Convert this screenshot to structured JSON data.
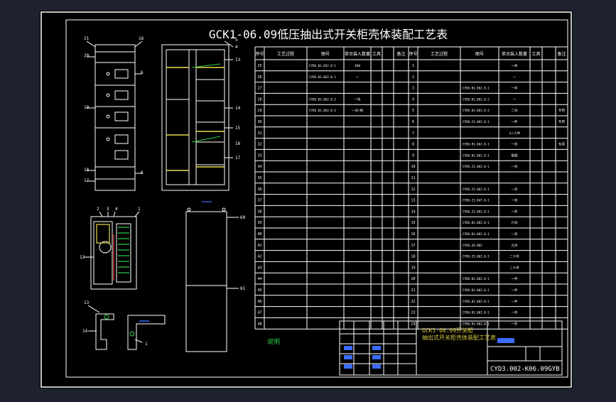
{
  "drawing": {
    "title": "GCK1-06.09低压抽出式开关柜壳体装配工艺表",
    "title_block_name": "GCK1-06.09开关柜抽出式开关柜壳体装配工艺表",
    "drawing_number": "CYD3.002-K06.09GYB",
    "note": "说明"
  },
  "colors": {
    "background": "#000000",
    "frame": "#ffffff",
    "title": "#ffffff",
    "table_text": "#ffffff",
    "accent_blue": "#3a6cff",
    "accent_green": "#2fd24a",
    "accent_yellow": "#e8d94a",
    "accent_red": "#e23a3a",
    "title_block_text": "#d8c840"
  },
  "table": {
    "headers_left": [
      "序号",
      "工艺过程",
      "图号",
      "单台装入数量",
      "工具",
      "备注"
    ],
    "headers_right": [
      "序号",
      "工艺过程",
      "图号",
      "单台装入数量",
      "工具",
      "备注"
    ],
    "left_rows": [
      [
        "25",
        "",
        "CYD6.01.047.0-1",
        "380",
        ""
      ],
      [
        "26",
        "",
        "CYD6.01.062.0-1",
        "一",
        ""
      ],
      [
        "27",
        "",
        "",
        "",
        ""
      ],
      [
        "28",
        "",
        "CYD6.01.062.0-2",
        "一块",
        ""
      ],
      [
        "29",
        "",
        "CYD6.01.062.0-2",
        "一块/根",
        ""
      ],
      [
        "30",
        "",
        "",
        "",
        ""
      ],
      [
        "31",
        "",
        "",
        "",
        ""
      ],
      [
        "32",
        "",
        "",
        "",
        ""
      ],
      [
        "33",
        "",
        "",
        "",
        ""
      ],
      [
        "34",
        "",
        "",
        "",
        ""
      ],
      [
        "35",
        "",
        "",
        "",
        ""
      ],
      [
        "36",
        "",
        "",
        "",
        ""
      ],
      [
        "37",
        "",
        "",
        "",
        ""
      ],
      [
        "38",
        "",
        "",
        "",
        ""
      ],
      [
        "39",
        "",
        "",
        "",
        ""
      ],
      [
        "40",
        "",
        "",
        "",
        ""
      ],
      [
        "41",
        "",
        "",
        "",
        ""
      ],
      [
        "42",
        "",
        "",
        "",
        ""
      ],
      [
        "43",
        "",
        "",
        "",
        ""
      ],
      [
        "44",
        "",
        "",
        "",
        ""
      ],
      [
        "45",
        "",
        "",
        "",
        ""
      ],
      [
        "46",
        "",
        "",
        "",
        ""
      ],
      [
        "47",
        "",
        "",
        "",
        ""
      ],
      [
        "48",
        "",
        "",
        "",
        ""
      ]
    ],
    "right_rows": [
      [
        "1",
        "",
        "",
        "一体",
        ""
      ],
      [
        "2",
        "",
        "",
        "一",
        ""
      ],
      [
        "3",
        "",
        "CYD6.01.062.0-1",
        "一件",
        ""
      ],
      [
        "4",
        "",
        "CYD6.01.062.0-2",
        "一",
        ""
      ],
      [
        "5",
        "",
        "CYD6.01.062.0-2",
        "二块",
        "专用"
      ],
      [
        "6",
        "",
        "CYD6.21.062.0-1",
        "一件",
        "专用"
      ],
      [
        "7",
        "",
        "",
        "十/人件",
        ""
      ],
      [
        "8",
        "",
        "CYD6.01.062.0-1",
        "一块",
        "专用"
      ],
      [
        "9",
        "",
        "CYD6.01.062.0-1",
        "根据",
        ""
      ],
      [
        "10",
        "",
        "CYD6.21.062.0-1",
        "一块",
        ""
      ],
      [
        "11",
        "",
        "",
        "",
        ""
      ],
      [
        "12",
        "",
        "CYD6.21.062.0-1",
        "一块",
        ""
      ],
      [
        "13",
        "",
        "CYD6.21.047.0-1",
        "一块",
        ""
      ],
      [
        "14",
        "",
        "CYD6.21.062.0-1",
        "一件",
        ""
      ],
      [
        "15",
        "",
        "CYD6.01.062.0-1",
        "六块",
        ""
      ],
      [
        "16",
        "",
        "CYD6.01.062.0-1",
        "一块",
        ""
      ],
      [
        "17",
        "",
        "CYD6.26.002",
        "九块",
        ""
      ],
      [
        "18",
        "",
        "CYD6.25.062.0-1",
        "二十件",
        ""
      ],
      [
        "19",
        "",
        "",
        "二十件",
        ""
      ],
      [
        "20",
        "",
        "CYD6.01.062.0-1",
        "一件",
        ""
      ],
      [
        "21",
        "",
        "CYD6.01.062.0-1",
        "一件",
        ""
      ],
      [
        "22",
        "",
        "CYD6.01.062.0-1",
        "一件",
        ""
      ],
      [
        "23",
        "",
        "CYD6.01.062.0-1",
        "一件",
        ""
      ],
      [
        "24",
        "",
        "CYD6.01.062.0-1",
        "一件",
        ""
      ]
    ]
  },
  "callouts": {
    "front_view": [
      "21",
      "20",
      "19",
      "18",
      "17",
      "16",
      "6",
      "9"
    ],
    "frame_view": [
      "5",
      "4",
      "13",
      "14",
      "15",
      "16",
      "17"
    ],
    "side_view": [
      "2",
      "3",
      "4",
      "1",
      "12"
    ],
    "back_view": [
      "60",
      "61"
    ],
    "detail_view": [
      "13",
      "14",
      "1"
    ]
  }
}
